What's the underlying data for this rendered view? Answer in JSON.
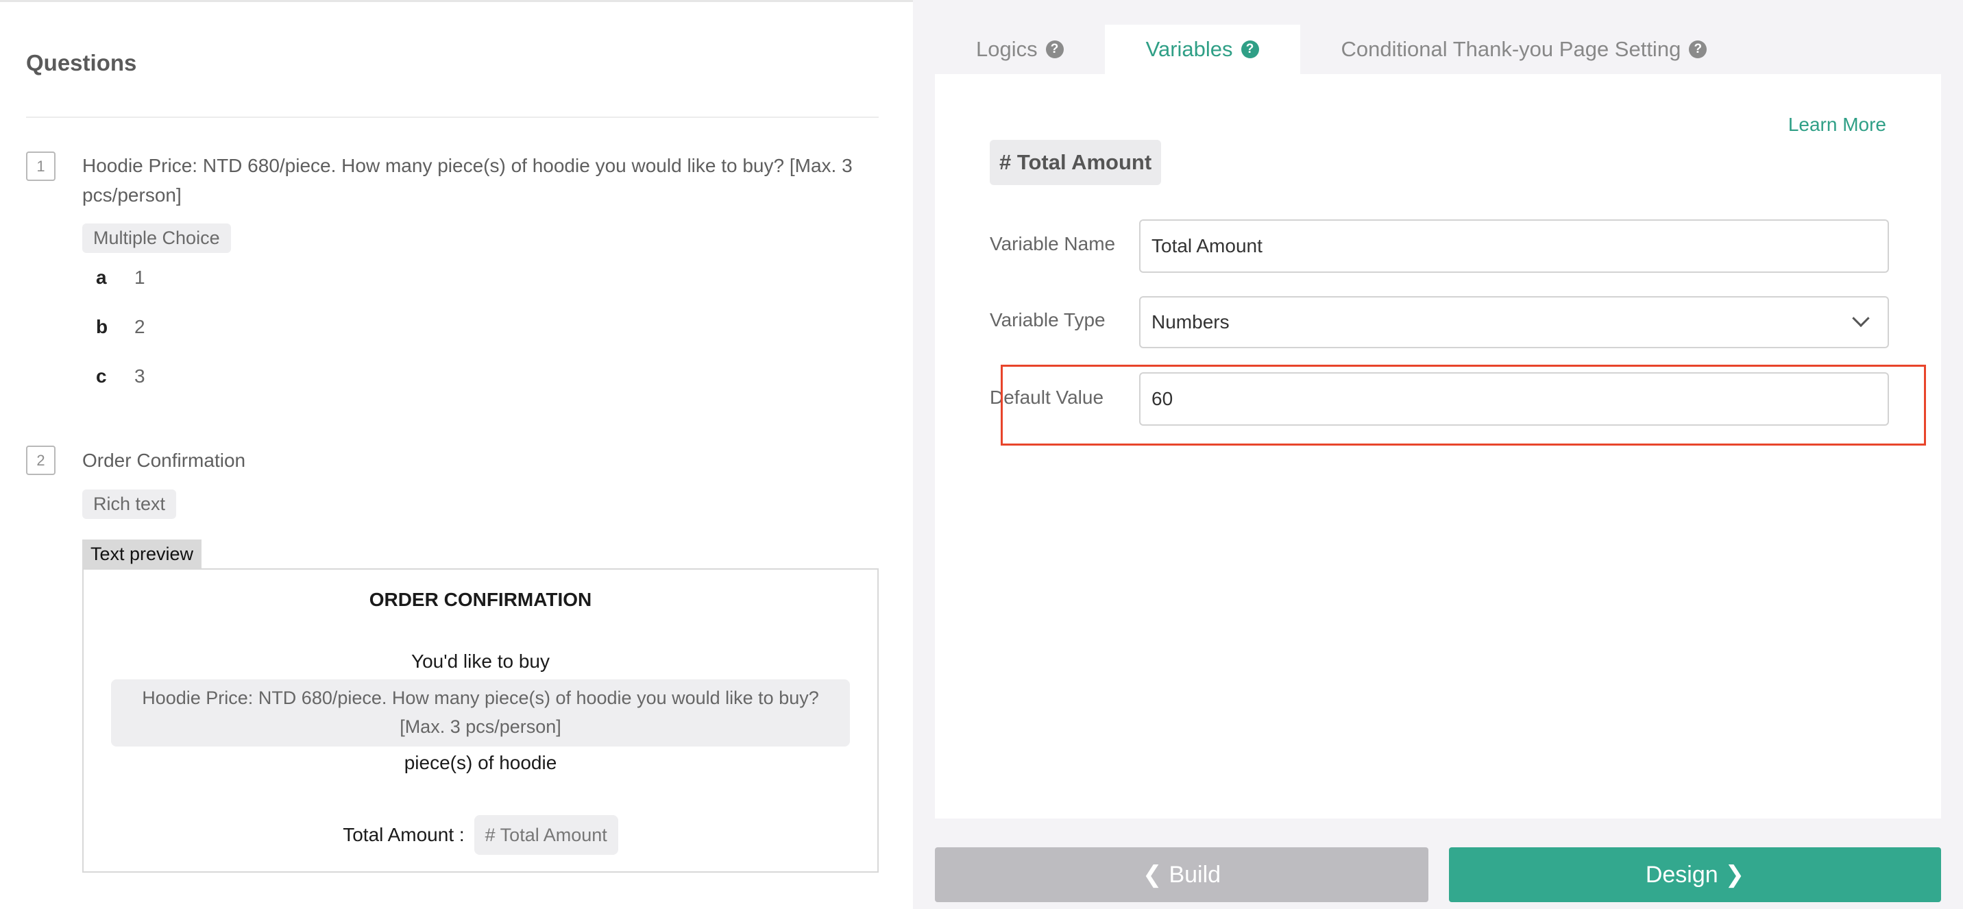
{
  "questions_panel": {
    "heading": "Questions",
    "q1": {
      "number": "1",
      "title": "Hoodie Price: NTD 680/piece. How many piece(s) of hoodie you would like to buy? [Max. 3 pcs/person]",
      "type": "Multiple Choice",
      "options": [
        {
          "letter": "a",
          "value": "1"
        },
        {
          "letter": "b",
          "value": "2"
        },
        {
          "letter": "c",
          "value": "3"
        }
      ]
    },
    "q2": {
      "number": "2",
      "title": "Order Confirmation",
      "type": "Rich text",
      "preview_tag": "Text preview",
      "preview": {
        "title": "ORDER CONFIRMATION",
        "line1": "You'd like to buy",
        "quote": "Hoodie Price: NTD 680/piece. How many piece(s) of hoodie you would like to buy? [Max. 3 pcs/person]",
        "line2": "piece(s) of hoodie",
        "total_label": "Total Amount :",
        "total_chip": "# Total Amount"
      }
    }
  },
  "tabs": [
    {
      "label": "Logics",
      "active": false
    },
    {
      "label": "Variables",
      "active": true
    },
    {
      "label": "Conditional Thank-you Page Setting",
      "active": false
    }
  ],
  "variable_card": {
    "learn_more": "Learn More",
    "title": "# Total Amount",
    "name_label": "Variable Name",
    "name_value": "Total Amount",
    "type_label": "Variable Type",
    "type_value": "Numbers",
    "default_label": "Default Value",
    "default_value": "60"
  },
  "footer": {
    "back_label": "Build",
    "next_label": "Design"
  },
  "colors": {
    "accent": "#33a88e",
    "highlight": "#e8452b",
    "build_button": "#bdbcc0"
  }
}
